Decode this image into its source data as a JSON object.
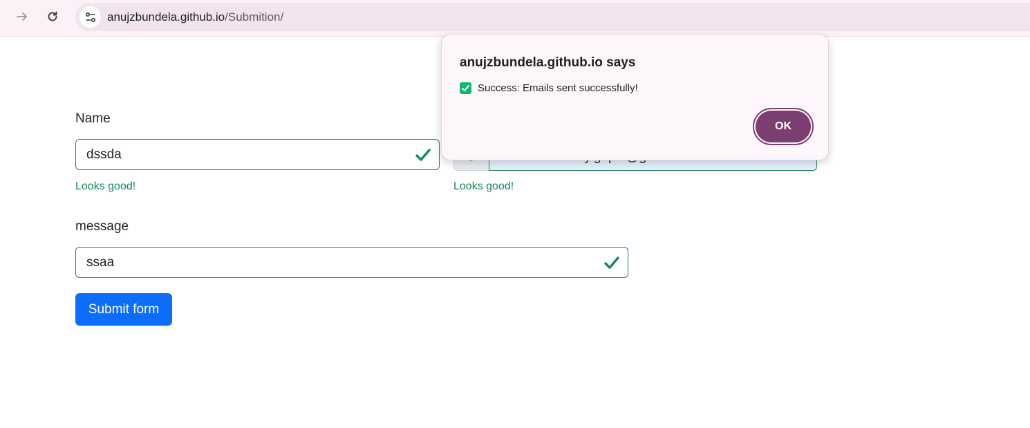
{
  "browser": {
    "url_host": "anujzbundela.github.io",
    "url_path": "/Submition/",
    "icons": [
      "forward-arrow-icon",
      "reload-icon",
      "site-info-icon"
    ]
  },
  "form": {
    "name_label": "Name",
    "name_value": "dssda",
    "name_feedback": "Looks good!",
    "email_prefix": "@",
    "email_value": "nikhilchaudhary.gopal@gmail.com",
    "email_feedback": "Looks good!",
    "message_label": "message",
    "message_value": "ssaa",
    "submit_label": "Submit form",
    "valid_color": "#198754",
    "submit_color": "#0d6efd"
  },
  "dialog": {
    "title": "anujzbundela.github.io says",
    "message": "Success: Emails sent successfully!",
    "ok_label": "OK",
    "accent_color": "#7a3f6f"
  }
}
